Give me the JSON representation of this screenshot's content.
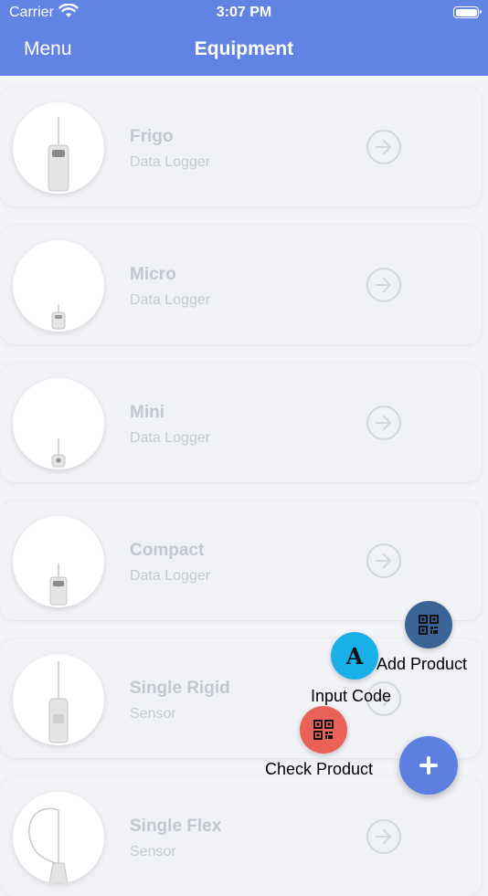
{
  "status_bar": {
    "carrier": "Carrier",
    "time": "3:07 PM"
  },
  "nav": {
    "menu_label": "Menu",
    "title": "Equipment"
  },
  "equipment": [
    {
      "name": "Frigo",
      "type": "Data Logger"
    },
    {
      "name": "Micro",
      "type": "Data Logger"
    },
    {
      "name": "Mini",
      "type": "Data Logger"
    },
    {
      "name": "Compact",
      "type": "Data Logger"
    },
    {
      "name": "Single Rigid",
      "type": "Sensor"
    },
    {
      "name": "Single Flex",
      "type": "Sensor"
    }
  ],
  "fab": {
    "add_product_label": "Add Product",
    "input_code_label": "Input Code",
    "input_code_icon_letter": "A",
    "check_product_label": "Check Product"
  },
  "colors": {
    "header": "#6183e4",
    "fab_main": "#5d7fe0",
    "add_product": "#3a6496",
    "input_code": "#19b0e8",
    "check_product": "#e9625a"
  },
  "icons": {
    "add_product": "qr-code-icon",
    "input_code": "letter-a-icon",
    "check_product": "qr-code-icon",
    "fab_main": "plus-icon",
    "row_action": "arrow-right-circle-icon"
  }
}
